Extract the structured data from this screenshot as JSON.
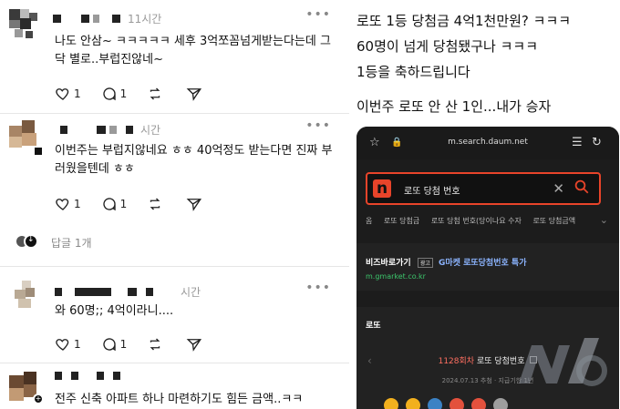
{
  "feed": {
    "posts": [
      {
        "time": "11시간",
        "text": "나도 안삼~ ㅋㅋㅋㅋㅋ 세후 3억쪼꼼넘게받는다는데 그닥 별로..부럽진않네~",
        "likes": "1",
        "comments": "1"
      },
      {
        "time": "시간",
        "text": "이번주는 부럽지않네요 ㅎㅎ 40억정도 받는다면 진짜 부러웠을텐데 ㅎㅎ",
        "likes": "1",
        "comments": "1"
      },
      {
        "time": "시간",
        "text": "와 60명;; 4억이라니....",
        "likes": "1",
        "comments": "1"
      },
      {
        "time": "",
        "text": "전주 신축 아파트 하나 마련하기도 힘든 금액..ㅋㅋ",
        "likes": "",
        "comments": ""
      }
    ],
    "replies_label": "답글 1개",
    "more_icon": "more-dots-icon"
  },
  "article": {
    "caption_lines": [
      "로또 1등 당첨금 4억1천만원? ㅋㅋㅋ",
      "60명이 넘게 당첨됐구나 ㅋㅋㅋ",
      "1등을 축하드립니다",
      "이번주 로또 안 산 1인...내가 승자"
    ]
  },
  "phone": {
    "url": "m.search.daum.net",
    "logo": "n",
    "query": "로또 당첨 번호",
    "tabs": [
      "옴",
      "로또 당첨금",
      "로또 당첨 번호(당이나요 수자",
      "로또 당첨금액"
    ],
    "ad_title": "비즈바로가기",
    "ad_badge": "광고",
    "ad_text": "G마켓 로또당첨번호 특가",
    "ad_url": "m.gmarket.co.kr",
    "section": "로또",
    "round_num": "1128회차",
    "round_label": "로또 당첨번호",
    "date": "2024.07.13 추첨 · 지급기한 1년",
    "accent": "#e8442a",
    "ball_colors": [
      "#f2b01e",
      "#f2b01e",
      "#3b82c4",
      "#e3513d",
      "#e3513d",
      "#9e9e9e"
    ]
  }
}
